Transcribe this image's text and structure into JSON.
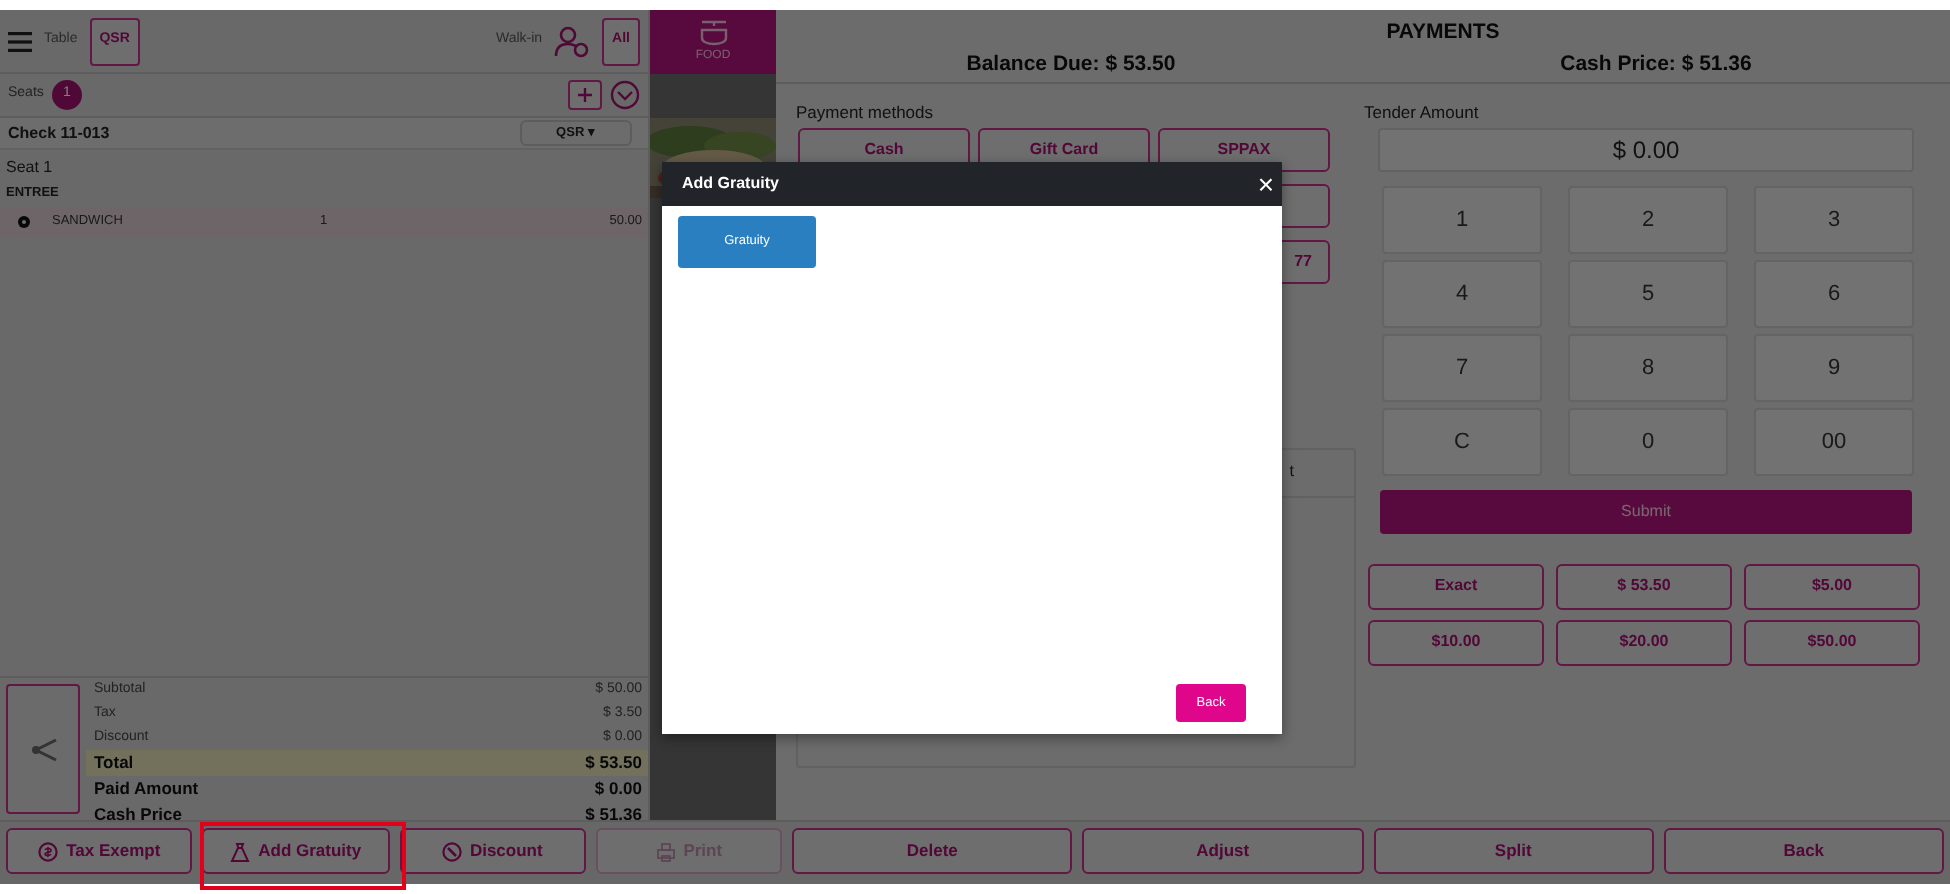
{
  "header": {
    "table_label": "Table",
    "table_button": "QSR",
    "walk_in": "Walk-in",
    "all_button": "All"
  },
  "category": {
    "label": "FOOD",
    "selected": true
  },
  "seats": {
    "label": "Seats",
    "count": "1"
  },
  "check": {
    "title": "Check 11-013",
    "type": "QSR ▾"
  },
  "seat_label": "Seat 1",
  "sections": [
    {
      "title": "ENTREE",
      "items": [
        {
          "name": "SANDWICH",
          "qty": "1",
          "price": "50.00"
        }
      ]
    }
  ],
  "summary": [
    {
      "label": "Subtotal",
      "value": "$ 50.00",
      "kind": "minor"
    },
    {
      "label": "Tax",
      "value": "$ 3.50",
      "kind": "minor"
    },
    {
      "label": "Discount",
      "value": "$ 0.00",
      "kind": "minor"
    },
    {
      "label": "Total",
      "value": "$ 53.50",
      "kind": "total"
    },
    {
      "label": "Paid Amount",
      "value": "$ 0.00",
      "kind": "major"
    },
    {
      "label": "Cash Price",
      "value": "$ 51.36",
      "kind": "major"
    }
  ],
  "order_actions": [
    {
      "label": "Tax Exempt",
      "kind": "coin",
      "disabled": false,
      "highlighted": false
    },
    {
      "label": "Add Gratuity",
      "kind": "bag",
      "disabled": false,
      "highlighted": true
    },
    {
      "label": "Discount",
      "kind": "discount",
      "disabled": false,
      "highlighted": false
    },
    {
      "label": "Print",
      "kind": "printer",
      "disabled": true,
      "highlighted": false
    }
  ],
  "payments": {
    "title": "PAYMENTS",
    "balance_due": "Balance Due: $ 53.50",
    "cash_price": "Cash Price: $ 51.36",
    "methods_label": "Payment methods",
    "methods": [
      {
        "label": "Cash",
        "kind": "button"
      },
      {
        "label": "Gift Card",
        "kind": "button"
      },
      {
        "label": "SPPAX",
        "kind": "button"
      },
      {
        "kind": "hidden"
      },
      {
        "kind": "hidden"
      },
      {
        "kind": "blank"
      },
      {
        "kind": "hidden"
      },
      {
        "kind": "hidden"
      },
      {
        "label": "77",
        "kind": "button"
      }
    ],
    "panel_header": "t"
  },
  "tender": {
    "label": "Tender Amount",
    "amount": "$ 0.00",
    "keys": [
      "1",
      "2",
      "3",
      "4",
      "5",
      "6",
      "7",
      "8",
      "9",
      "C",
      "0",
      "00"
    ],
    "submit": "Submit",
    "quick": [
      "Exact",
      "$ 53.50",
      "$5.00",
      "$10.00",
      "$20.00",
      "$50.00"
    ]
  },
  "payment_actions": [
    "Delete",
    "Adjust",
    "Split",
    "Back"
  ],
  "modal": {
    "title": "Add Gratuity",
    "close": "×",
    "options": [
      {
        "label": "Gratuity"
      }
    ],
    "back": "Back"
  }
}
